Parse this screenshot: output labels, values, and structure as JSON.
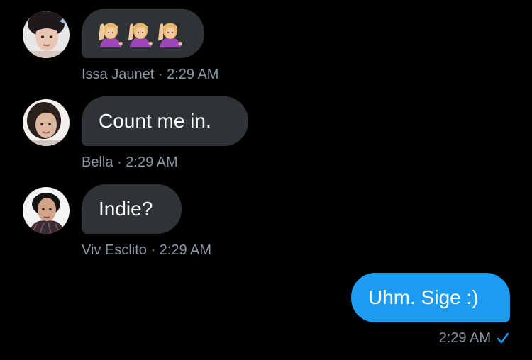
{
  "messages": [
    {
      "sender": "Issa Jaunet",
      "time": "2:29 AM",
      "emoji_count": 3,
      "avatar_icon": "person-photo-icon"
    },
    {
      "sender": "Bella",
      "time": "2:29 AM",
      "text": "Count me in.",
      "avatar_icon": "person-photo-icon"
    },
    {
      "sender": "Viv Esclito",
      "time": "2:29 AM",
      "text": "Indie?",
      "avatar_icon": "person-photo-icon"
    },
    {
      "outgoing": true,
      "text": "Uhm. Sige :)",
      "time": "2:29 AM",
      "status_icon": "sent-check-icon"
    }
  ],
  "colors": {
    "background": "#000000",
    "incoming_bubble": "#2f3336",
    "outgoing_bubble": "#1d9bf0",
    "meta_text": "#8b98a5"
  },
  "meta_separator": " · "
}
